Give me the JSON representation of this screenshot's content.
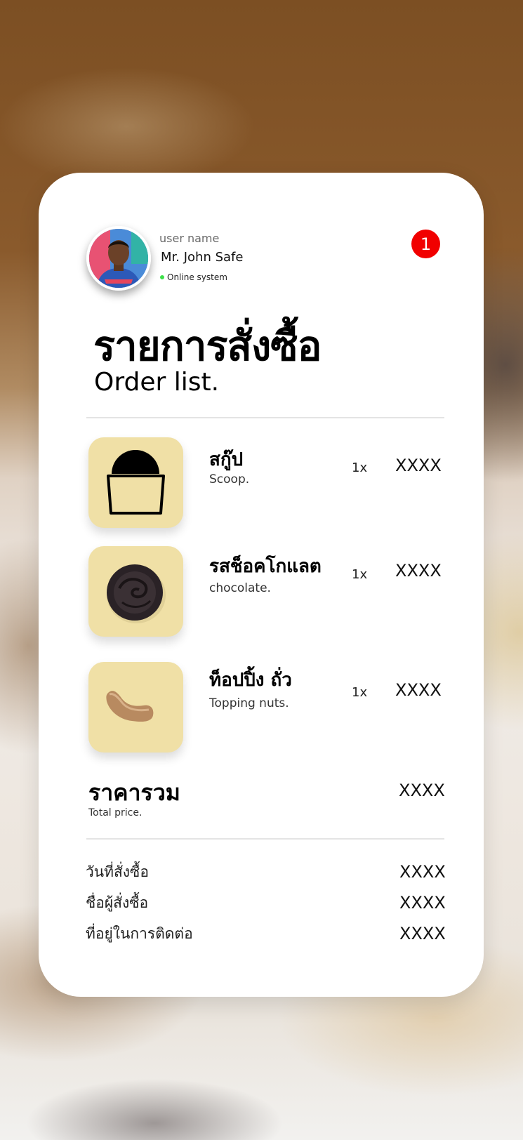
{
  "user": {
    "label": "user name",
    "name": "Mr. John Safe",
    "status": "Online system",
    "status_color": "#3ee04a"
  },
  "notification": {
    "count": "1",
    "color": "#f10000",
    "icon": "notification-badge"
  },
  "header": {
    "title_th": "รายการสั่งซื้อ",
    "title_en": "Order list."
  },
  "items": [
    {
      "name_th": "สกู๊ป",
      "name_en": "Scoop.",
      "qty": "1x",
      "price": "XXXX",
      "icon": "scoop-icon"
    },
    {
      "name_th": "รสช็อคโกแลต",
      "name_en": "chocolate.",
      "qty": "1x",
      "price": "XXXX",
      "icon": "chocolate-icon"
    },
    {
      "name_th": "ท็อปปิ้ง ถั่ว",
      "name_en": "Topping nuts.",
      "qty": "1x",
      "price": "XXXX",
      "icon": "nut-icon"
    }
  ],
  "total": {
    "label_th": "ราคารวม",
    "label_en": "Total price.",
    "value": "XXXX"
  },
  "details": [
    {
      "label": "วันที่สั่งซื้อ",
      "value": "XXXX"
    },
    {
      "label": "ชื่อผู้สั่งซื้อ",
      "value": "XXXX"
    },
    {
      "label": "ที่อยู่ในการติดต่อ",
      "value": "XXXX"
    }
  ],
  "colors": {
    "card": "#ffffff",
    "thumb": "#f0e0a6",
    "accent": "#f10000"
  }
}
